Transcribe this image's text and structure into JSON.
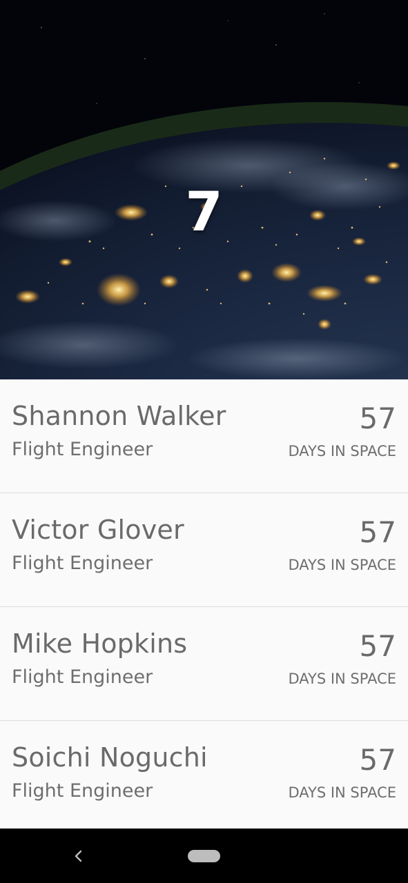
{
  "hero": {
    "people_count": "7",
    "background": "earth-at-night-from-orbit"
  },
  "colors": {
    "list_background": "#fafafa",
    "text_primary": "#6a6a6a",
    "divider": "#dcdcdc",
    "navbar": "#000000"
  },
  "crew": [
    {
      "name": "Shannon Walker",
      "role": "Flight Engineer",
      "days": "57",
      "days_label": "DAYS IN SPACE"
    },
    {
      "name": "Victor Glover",
      "role": "Flight Engineer",
      "days": "57",
      "days_label": "DAYS IN SPACE"
    },
    {
      "name": "Mike Hopkins",
      "role": "Flight Engineer",
      "days": "57",
      "days_label": "DAYS IN SPACE"
    },
    {
      "name": "Soichi Noguchi",
      "role": "Flight Engineer",
      "days": "57",
      "days_label": "DAYS IN SPACE"
    }
  ],
  "navbar": {
    "back_icon": "chevron-left-icon",
    "home_icon": "home-pill-icon"
  }
}
